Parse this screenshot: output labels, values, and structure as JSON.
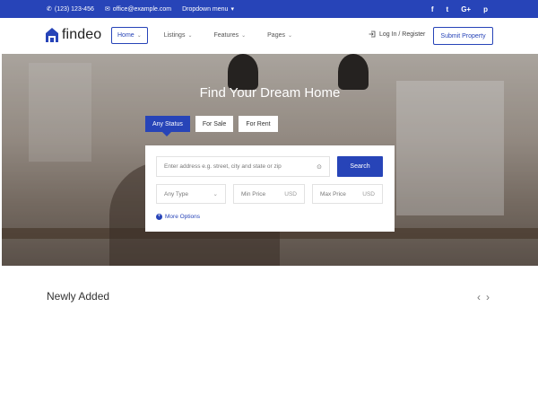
{
  "topbar": {
    "phone": "(123) 123-456",
    "email": "office@example.com",
    "dropdown": "Dropdown menu",
    "dropdown_caret": "▾",
    "social": [
      "f",
      "t",
      "G+",
      "p"
    ]
  },
  "header": {
    "logo_text": "findeo",
    "nav": [
      {
        "label": "Home",
        "chevron": "⌄"
      },
      {
        "label": "Listings",
        "chevron": "⌄"
      },
      {
        "label": "Features",
        "chevron": "⌄"
      },
      {
        "label": "Pages",
        "chevron": "⌄"
      }
    ],
    "login": "Log In / Register",
    "submit": "Submit Property"
  },
  "hero": {
    "title": "Find Your Dream Home",
    "tabs": [
      "Any Status",
      "For Sale",
      "For Rent"
    ],
    "address_placeholder": "Enter address e.g. street, city and state or zip",
    "search_label": "Search",
    "type_placeholder": "Any Type",
    "min_price": "Min Price",
    "max_price": "Max Price",
    "currency": "USD",
    "more_options": "More Options"
  },
  "section": {
    "title": "Newly Added",
    "prev": "‹",
    "next": "›"
  },
  "colors": {
    "accent": "#2744b8"
  },
  "icons": {
    "phone": "phone-icon",
    "email": "envelope-icon",
    "login": "login-icon",
    "locate": "crosshair-icon"
  }
}
